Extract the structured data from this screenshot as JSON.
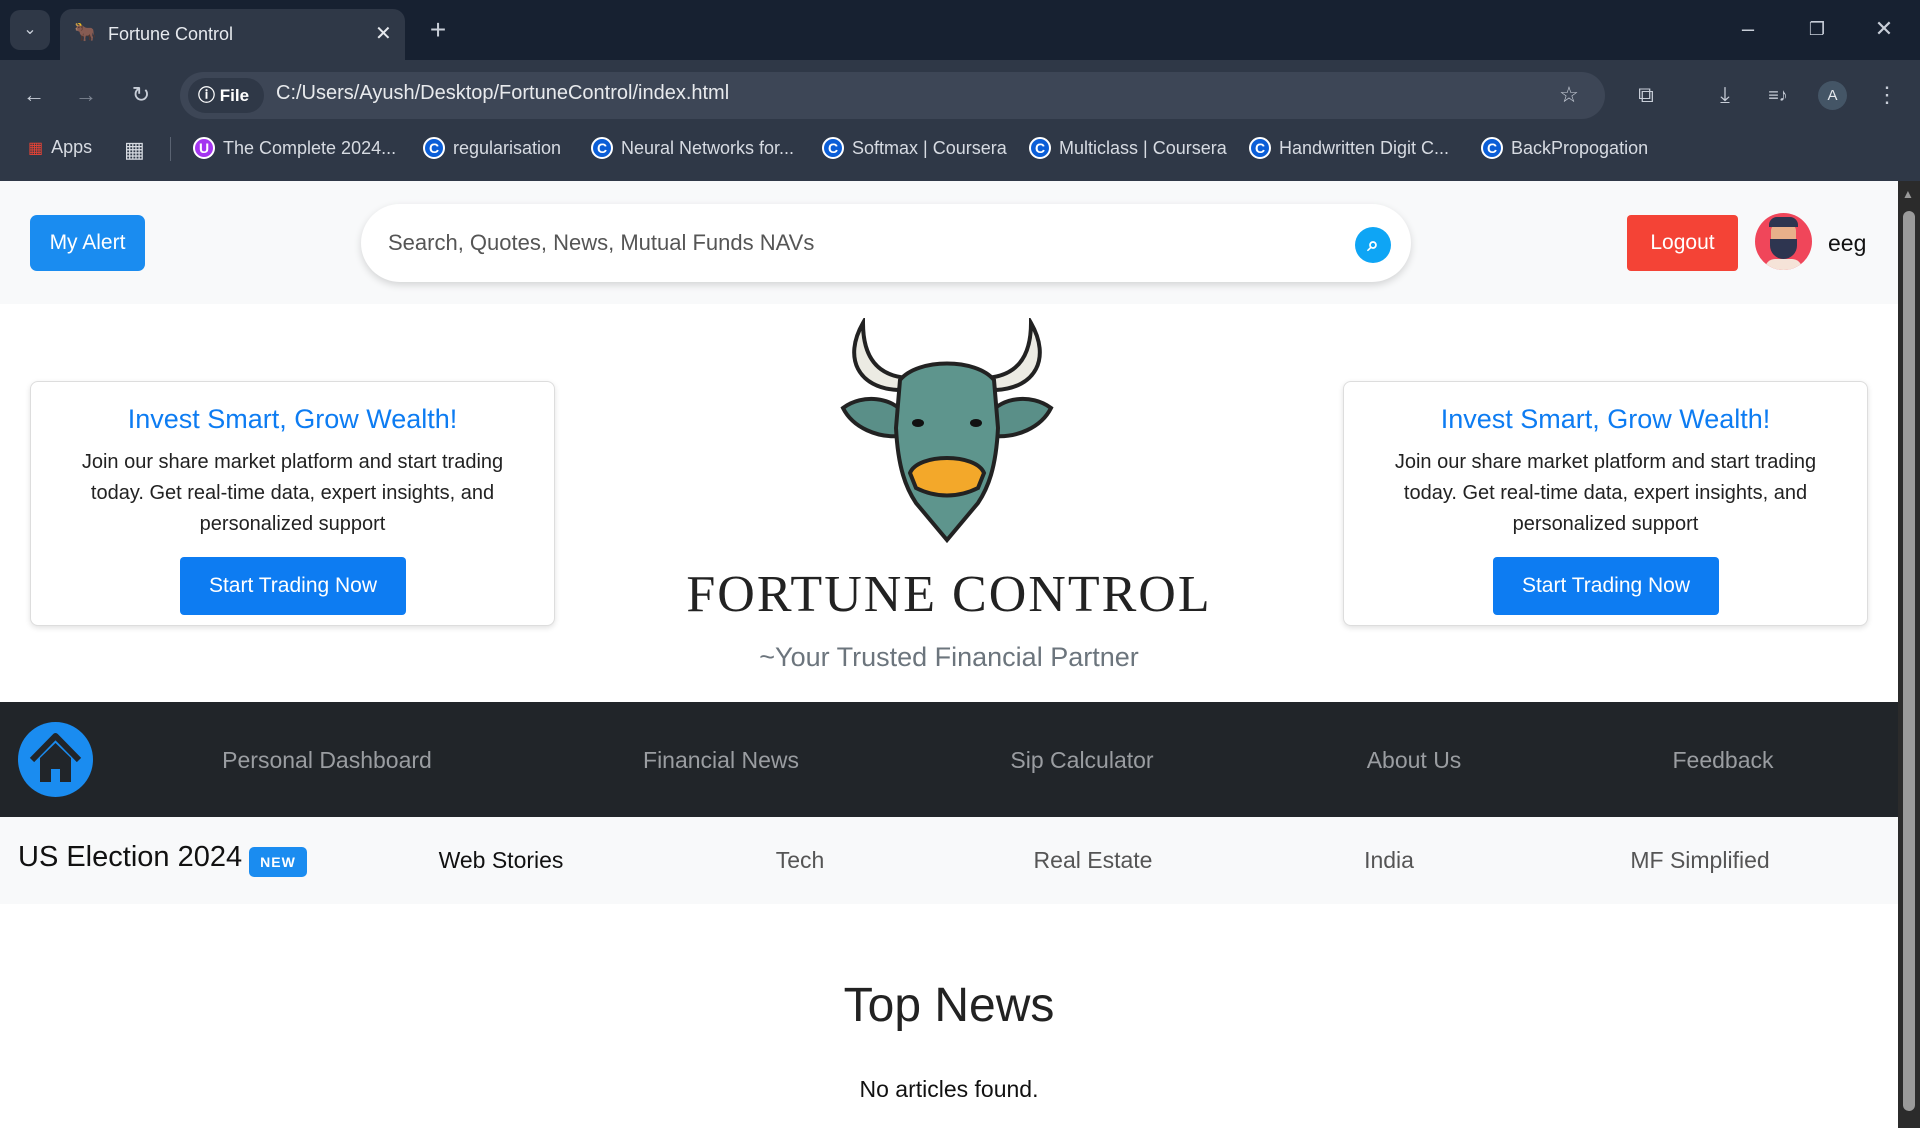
{
  "browser": {
    "tab_title": "Fortune Control",
    "url_chip": "File",
    "url": "C:/Users/Ayush/Desktop/FortuneControl/index.html",
    "profile_initial": "A",
    "bookmarks": [
      {
        "label": "Apps",
        "icon": "apps-grid-icon"
      },
      {
        "label": "The Complete 2024...",
        "icon": "udemy-icon"
      },
      {
        "label": "regularisation",
        "icon": "coursera-icon"
      },
      {
        "label": "Neural Networks for...",
        "icon": "coursera-icon"
      },
      {
        "label": "Softmax | Coursera",
        "icon": "coursera-icon"
      },
      {
        "label": "Multiclass | Coursera",
        "icon": "coursera-icon"
      },
      {
        "label": "Handwritten Digit C...",
        "icon": "coursera-icon"
      },
      {
        "label": "BackPropogation",
        "icon": "coursera-icon"
      }
    ]
  },
  "header": {
    "alert_label": "My Alert",
    "search_placeholder": "Search, Quotes, News, Mutual Funds NAVs",
    "logout_label": "Logout",
    "username": "eeg"
  },
  "hero": {
    "card_title": "Invest Smart, Grow Wealth!",
    "card_text": "Join our share market platform and start trading today. Get real-time data, expert insights, and personalized support",
    "card_cta": "Start Trading Now",
    "brand": "FORTUNE CONTROL",
    "tagline": "~Your Trusted Financial Partner"
  },
  "nav": {
    "items": [
      "Personal Dashboard",
      "Financial News",
      "Sip Calculator",
      "About Us",
      "Feedback"
    ]
  },
  "subnav": {
    "headline": "US Election 2024",
    "badge": "NEW",
    "items": [
      "Web Stories",
      "Tech",
      "Real Estate",
      "India",
      "MF Simplified"
    ]
  },
  "news": {
    "title": "Top News",
    "empty": "No articles found."
  },
  "colors": {
    "accent": "#0d7cf2",
    "logout": "#f44336",
    "nav_bg": "#212529"
  }
}
